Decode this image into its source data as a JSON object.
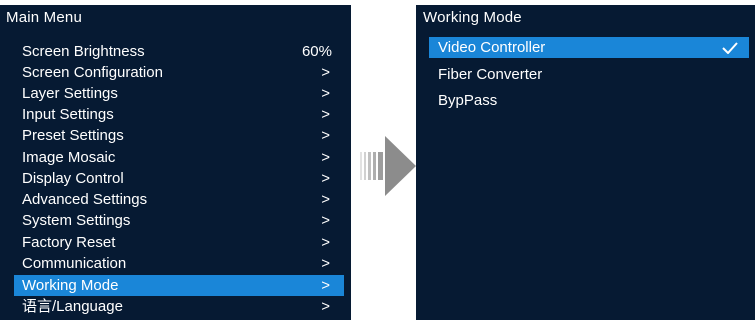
{
  "main_menu": {
    "title": "Main Menu",
    "items": [
      {
        "label": "Screen Brightness",
        "value": "60%"
      },
      {
        "label": "Screen Configuration",
        "value": ">"
      },
      {
        "label": "Layer Settings",
        "value": ">"
      },
      {
        "label": "Input Settings",
        "value": ">"
      },
      {
        "label": "Preset Settings",
        "value": ">"
      },
      {
        "label": "Image Mosaic",
        "value": ">"
      },
      {
        "label": "Display Control",
        "value": ">"
      },
      {
        "label": "Advanced Settings",
        "value": ">"
      },
      {
        "label": "System Settings",
        "value": ">"
      },
      {
        "label": "Factory Reset",
        "value": ">"
      },
      {
        "label": "Communication",
        "value": ">"
      },
      {
        "label": "Working Mode",
        "value": ">"
      },
      {
        "label": "语言/Language",
        "value": ">"
      }
    ],
    "selected_index": 11
  },
  "working_mode": {
    "title": "Working Mode",
    "items": [
      {
        "label": "Video Controller",
        "checked": true
      },
      {
        "label": "Fiber Converter",
        "checked": false
      },
      {
        "label": "BypPass",
        "checked": false
      }
    ],
    "selected_index": 0
  },
  "colors": {
    "screen_background": "#061a33",
    "selection_highlight": "#1a86d8",
    "text": "#ffffff",
    "arrow_gray": "#8c8c8c"
  },
  "icons": {
    "transition_arrow": "right-arrow-icon",
    "check": "check-icon"
  }
}
